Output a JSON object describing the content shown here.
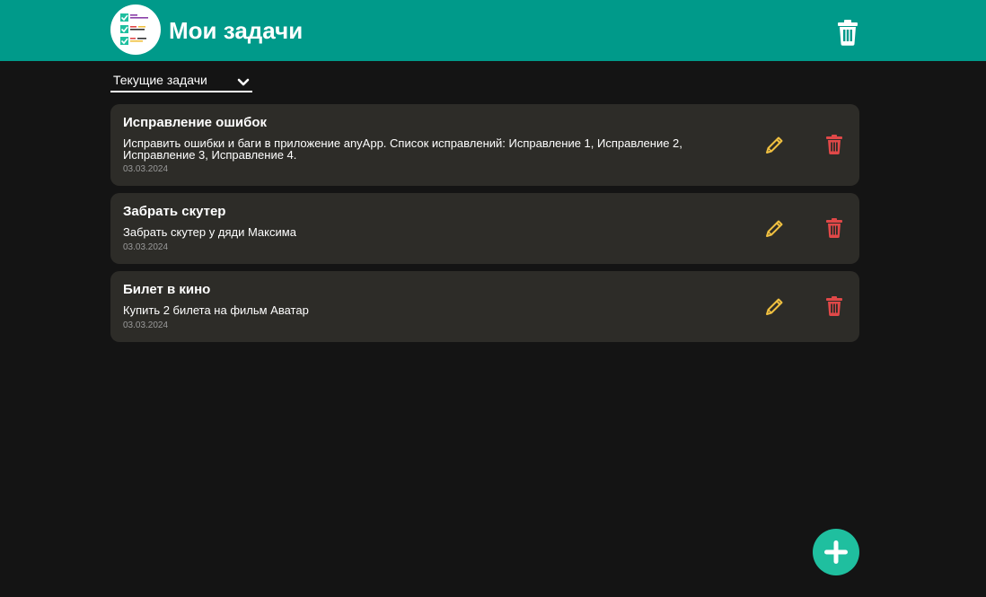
{
  "header": {
    "title": "Мои задачи"
  },
  "filter": {
    "selected": "Текущие задачи"
  },
  "tasks": [
    {
      "title": "Исправление ошибок",
      "description": "Исправить ошибки и баги в приложение anyApp. Список исправлений: Исправление 1, Исправление 2, Исправление 3, Исправление 4.",
      "date": "03.03.2024"
    },
    {
      "title": "Забрать скутер",
      "description": "Забрать скутер у дяди Максима",
      "date": "03.03.2024"
    },
    {
      "title": "Билет в кино",
      "description": "Купить 2 билета на фильм Аватар",
      "date": "03.03.2024"
    }
  ],
  "icons": {
    "logo": "checklist-logo-icon",
    "clear_all": "trash-icon",
    "filter_toggle": "chevron-down-icon",
    "edit": "pencil-icon",
    "delete": "trash-icon",
    "add": "plus-icon"
  },
  "colors": {
    "header_bg": "#009a8a",
    "page_bg": "#141414",
    "card_bg": "#2d2c28",
    "edit_icon": "#f0c040",
    "delete_icon": "#e04848",
    "fab_bg": "#1fbf9f"
  }
}
